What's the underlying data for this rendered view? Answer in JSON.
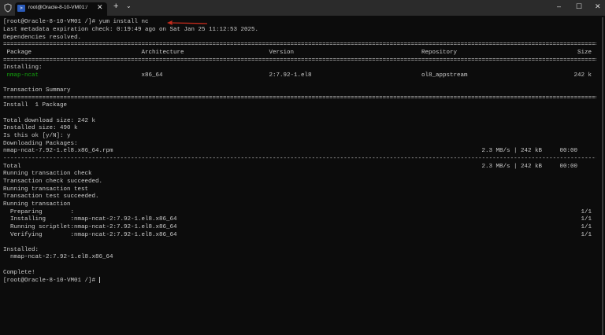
{
  "window": {
    "tab_title": "root@Oracle-8-10-VM01:/",
    "tab_icon": "powershell-icon",
    "new_tab_label": "+",
    "tab_menu_label": "⌄",
    "minimize_label": "–",
    "maximize_label": "☐",
    "close_label": "✕"
  },
  "colors": {
    "background": "#0c0c0c",
    "text": "#cccccc",
    "package_green": "#13a10e",
    "arrow_red": "#c42b1c"
  },
  "terminal": {
    "prompt": "[root@Oracle-8-10-VM01 /]# ",
    "command": "yum install nc",
    "metadata": "Last metadata expiration check: 0:19:49 ago on Sat Jan 25 11:12:53 2025.",
    "deps": "Dependencies resolved.",
    "eq_sep": "==========================================================================================================================================================================",
    "dash_sep": "--------------------------------------------------------------------------------------------------------------------------------------------------------------------------",
    "table": {
      "headers": {
        "package": "Package",
        "arch": "Architecture",
        "version": "Version",
        "repo": "Repository",
        "size": "Size"
      },
      "section": "Installing:",
      "row": {
        "package": "nmap-ncat",
        "arch": "x86_64",
        "version": "2:7.92-1.el8",
        "repo": "ol8_appstream",
        "size": "242 k"
      }
    },
    "summary_title": "Transaction Summary",
    "install_count": "Install  1 Package",
    "download_size": "Total download size: 242 k",
    "installed_size": "Installed size: 490 k",
    "confirm": "Is this ok [y/N]: y",
    "downloading": "Downloading Packages:",
    "rpm": {
      "name": "nmap-ncat-7.92-1.el8.x86_64.rpm",
      "stats": "2.3 MB/s | 242 kB     00:00"
    },
    "total": {
      "label": "Total",
      "stats": "2.3 MB/s | 242 kB     00:00"
    },
    "steps": [
      "Running transaction check",
      "Transaction check succeeded.",
      "Running transaction test",
      "Transaction test succeeded.",
      "Running transaction"
    ],
    "progress": [
      {
        "label": "  Preparing        :",
        "pkg": "",
        "count": "1/1"
      },
      {
        "label": "  Installing       :",
        "pkg": "nmap-ncat-2:7.92-1.el8.x86_64",
        "count": "1/1"
      },
      {
        "label": "  Running scriptlet:",
        "pkg": "nmap-ncat-2:7.92-1.el8.x86_64",
        "count": "1/1"
      },
      {
        "label": "  Verifying        :",
        "pkg": "nmap-ncat-2:7.92-1.el8.x86_64",
        "count": "1/1"
      }
    ],
    "installed_label": "Installed:",
    "installed_pkg": "  nmap-ncat-2:7.92-1.el8.x86_64",
    "complete": "Complete!",
    "final_prompt": "[root@Oracle-8-10-VM01 /]# "
  }
}
